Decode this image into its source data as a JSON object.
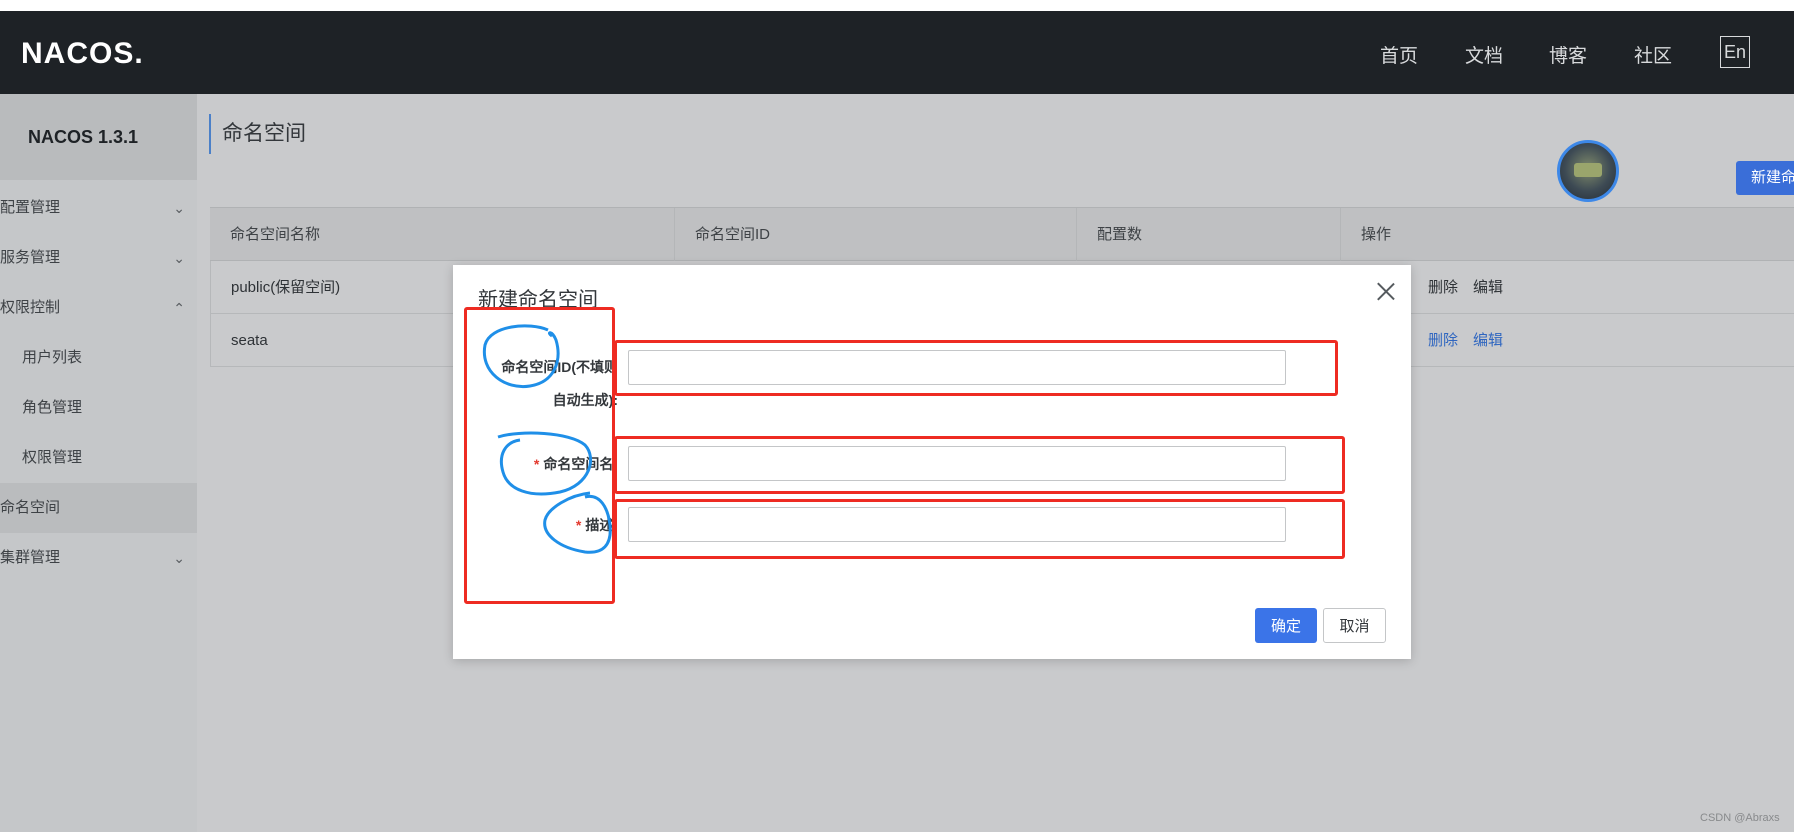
{
  "header": {
    "logo": "NACOS.",
    "nav": [
      "首页",
      "文档",
      "博客",
      "社区"
    ],
    "lang": "En"
  },
  "sidebar": {
    "version": "NACOS 1.3.1",
    "items": [
      {
        "label": "配置管理",
        "chevron": "chevron-down-icon"
      },
      {
        "label": "服务管理",
        "chevron": "chevron-down-icon"
      },
      {
        "label": "权限控制",
        "chevron": "chevron-up-icon"
      },
      {
        "label": "用户列表"
      },
      {
        "label": "角色管理"
      },
      {
        "label": "权限管理"
      },
      {
        "label": "命名空间"
      },
      {
        "label": "集群管理",
        "chevron": "chevron-down-icon"
      }
    ]
  },
  "main": {
    "title": "命名空间",
    "new_button": "新建命",
    "table": {
      "headers": [
        "命名空间名称",
        "命名空间ID",
        "配置数",
        "操作"
      ],
      "rows": [
        {
          "name": "public(保留空间)",
          "op_delete": "删除",
          "op_edit": "编辑"
        },
        {
          "name": "seata",
          "op_delete": "删除",
          "op_edit": "编辑"
        }
      ]
    }
  },
  "dialog": {
    "title": "新建命名空间",
    "field_id_label_line1": "命名空间ID(不填则",
    "field_id_label_line2": "自动生成):",
    "field_name_label": "命名空间名:",
    "field_desc_label": "描述:",
    "required_mark": "*",
    "field_id_value": "",
    "field_name_value": "",
    "field_desc_value": "",
    "ok_button": "确定",
    "cancel_button": "取消"
  },
  "watermark": "CSDN @Abraxs",
  "colors": {
    "topbar": "#1e2226",
    "primary": "#3b74e8",
    "annotation_red": "#ee2b22",
    "annotation_blue": "#1f8fe8"
  }
}
